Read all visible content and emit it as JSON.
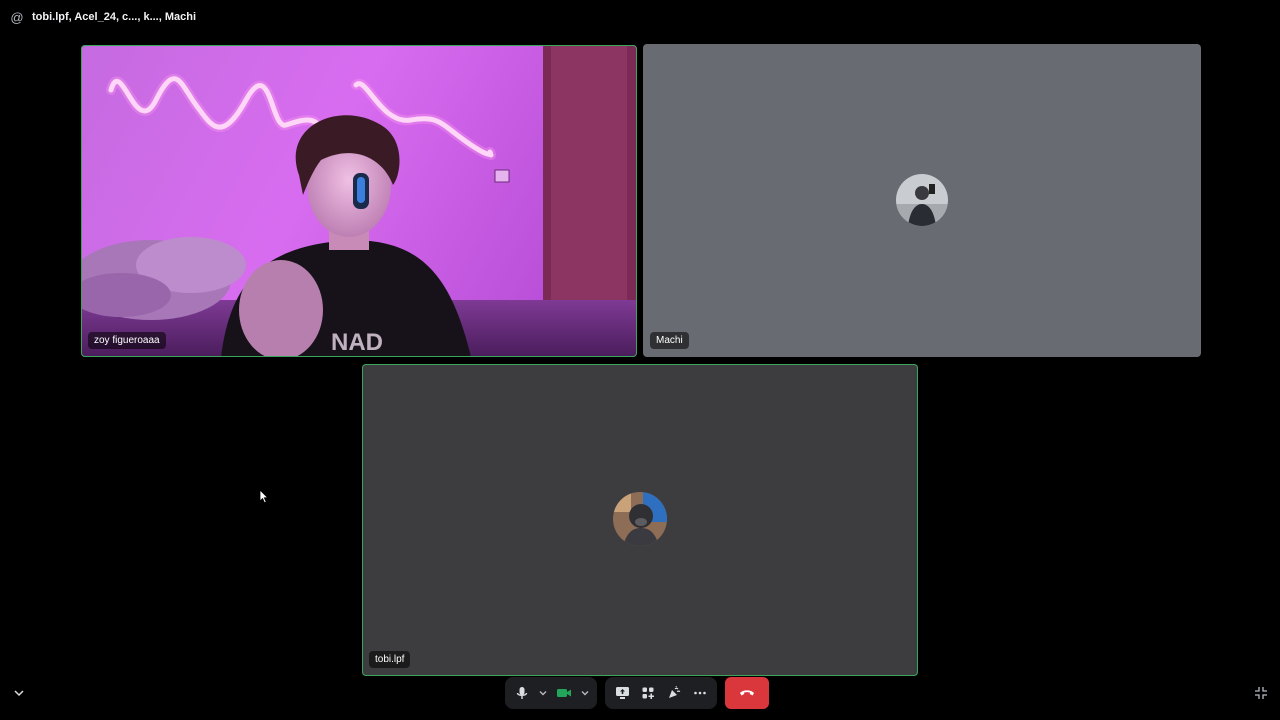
{
  "header": {
    "at_symbol": "@",
    "title": "tobi.lpf, Acel_24, c..., k..., Machi"
  },
  "participants": [
    {
      "name": "zoy figueroaaa",
      "video_on": true,
      "speaking": true
    },
    {
      "name": "Machi",
      "video_on": false,
      "speaking": false
    },
    {
      "name": "tobi.lpf",
      "video_on": false,
      "speaking": true
    }
  ],
  "controls": {
    "icons": [
      "microphone-icon",
      "chevron-down-icon",
      "camera-icon",
      "chevron-down-icon",
      "screen-share-icon",
      "activities-icon",
      "soundboard-icon",
      "more-icon",
      "hang-up-icon"
    ],
    "camera_active_color": "#23a55a",
    "hangup_color": "#da373c"
  },
  "colors": {
    "speaking_outline": "#3ba55c",
    "machi_tile_bg": "#686c72",
    "tobi_tile_bg": "#3d3d3f"
  }
}
